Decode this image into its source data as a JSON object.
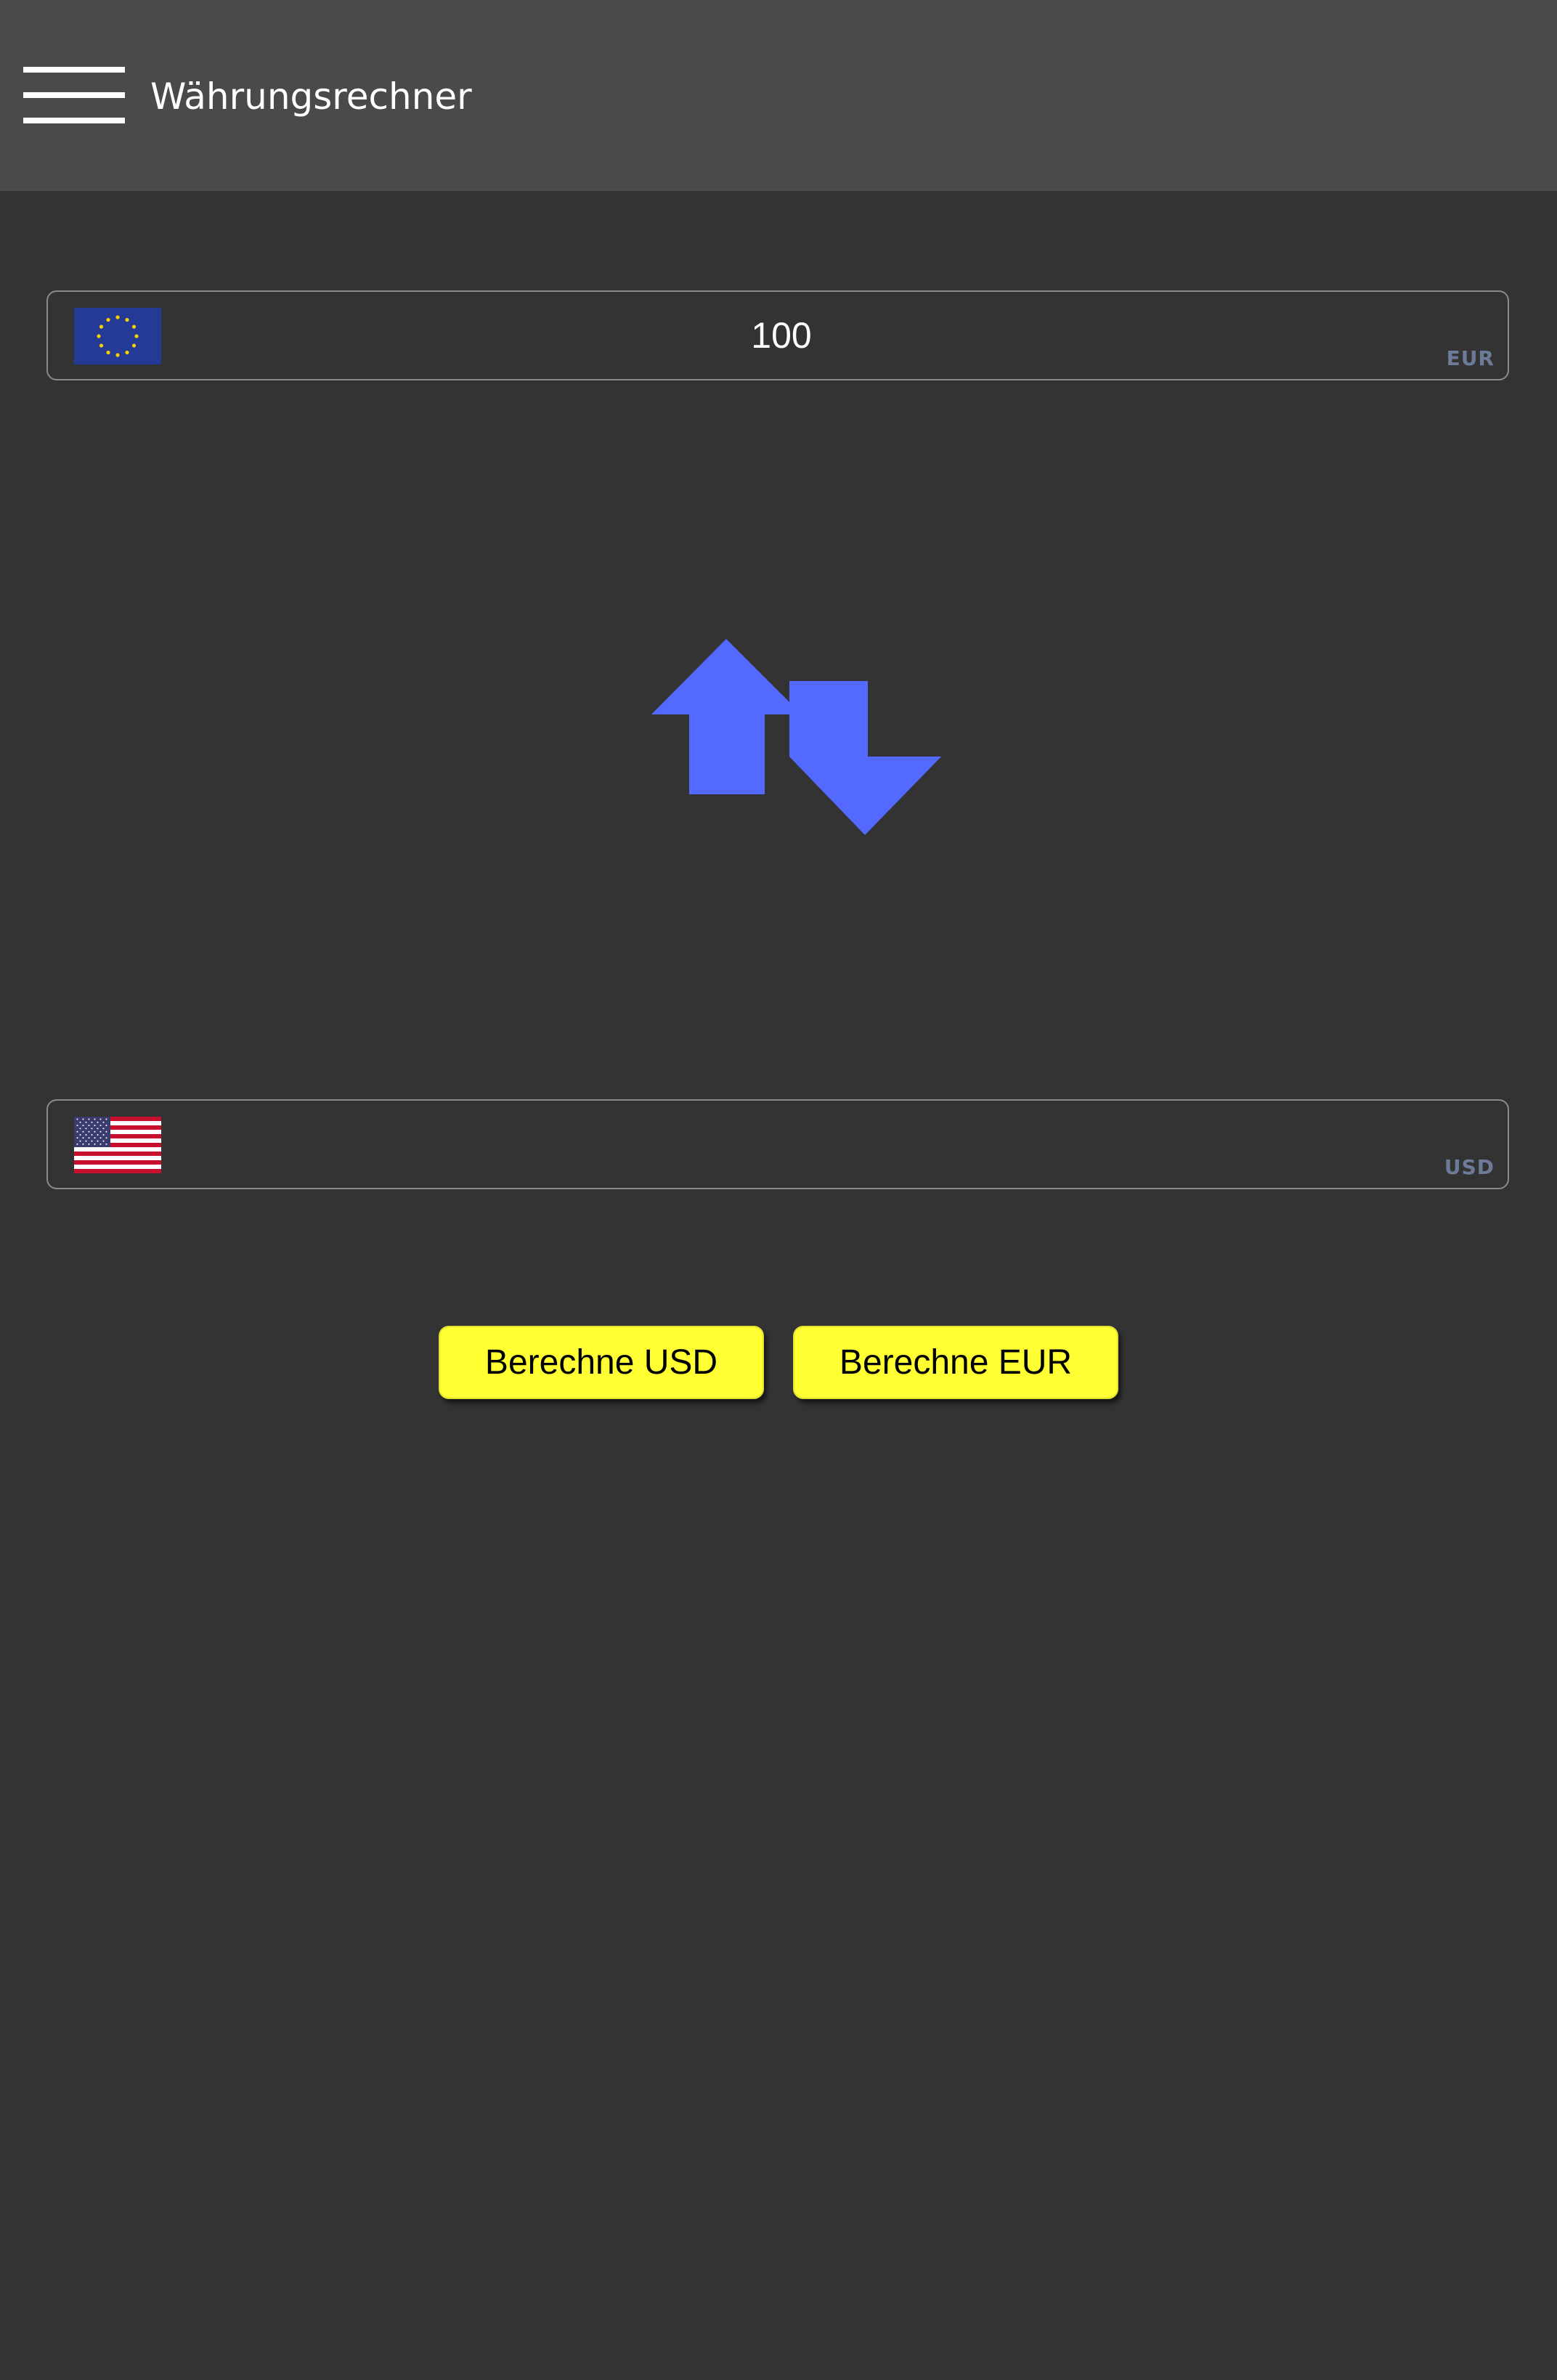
{
  "appbar": {
    "title": "Währungsrechner",
    "menu_icon": "hamburger-menu-icon"
  },
  "from": {
    "value": "100",
    "placeholder": "",
    "currency_code": "EUR",
    "flag_icon": "eu-flag-icon"
  },
  "swap": {
    "icon": "swap-arrows-icon",
    "color": "#5469ff"
  },
  "to": {
    "value": "",
    "placeholder": "",
    "currency_code": "USD",
    "flag_icon": "us-flag-icon"
  },
  "actions": {
    "calc_usd_label": "Berechne USD",
    "calc_eur_label": "Berechne EUR"
  },
  "colors": {
    "background": "#333333",
    "appbar": "#4a4a4a",
    "button": "#ffff33",
    "currency_code": "#6b7b98"
  }
}
